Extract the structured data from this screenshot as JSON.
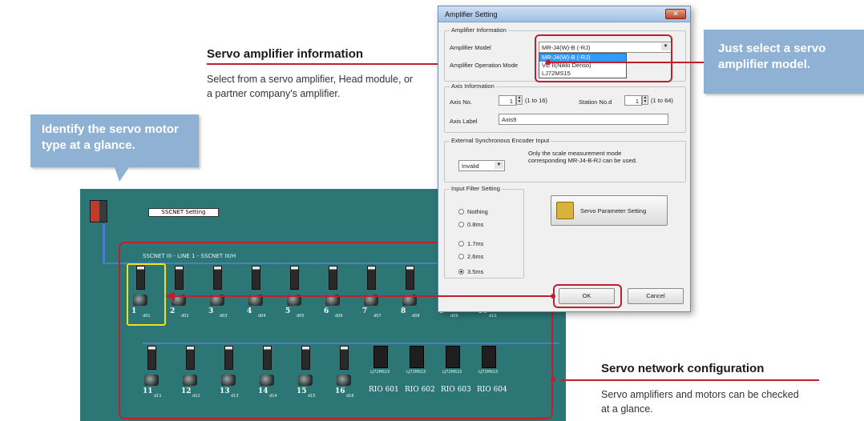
{
  "callouts": {
    "identify": "Identify the servo motor type at a glance.",
    "select_model": "Just select a servo amplifier model."
  },
  "sections": {
    "amp_info": {
      "heading": "Servo amplifier information",
      "body": "Select from a servo amplifier, Head module, or a partner company's amplifier."
    },
    "network": {
      "heading": "Servo network configuration",
      "body": "Servo amplifiers and motors can be checked at a glance."
    }
  },
  "network_panel": {
    "plc_label": "SSCNET Setting",
    "line_title": "SSCNET III - LINE 1 - SSCNET III/H",
    "row1": [
      {
        "num": "1",
        "sub": "d01"
      },
      {
        "num": "2",
        "sub": "d02"
      },
      {
        "num": "3",
        "sub": "d03"
      },
      {
        "num": "4",
        "sub": "d04"
      },
      {
        "num": "5",
        "sub": "d05"
      },
      {
        "num": "6",
        "sub": "d06"
      },
      {
        "num": "7",
        "sub": "d07"
      },
      {
        "num": "8",
        "sub": "d08"
      },
      {
        "num": "9",
        "sub": "d09"
      },
      {
        "num": "10",
        "sub": "d10"
      }
    ],
    "row2": [
      {
        "num": "11",
        "sub": "d11"
      },
      {
        "num": "12",
        "sub": "d12"
      },
      {
        "num": "13",
        "sub": "d13"
      },
      {
        "num": "14",
        "sub": "d14"
      },
      {
        "num": "15",
        "sub": "d15"
      },
      {
        "num": "16",
        "sub": "d16"
      }
    ],
    "rio": [
      {
        "label": "RIO 601",
        "tag": "LJ72MS15"
      },
      {
        "label": "RIO 602",
        "tag": "LJ72MS15"
      },
      {
        "label": "RIO 603",
        "tag": "LJ72MS15"
      },
      {
        "label": "RIO 604",
        "tag": "LJ72MS15"
      }
    ]
  },
  "dialog": {
    "title": "Amplifier Setting",
    "close": "✕",
    "amp_info_group": "Amplifier Information",
    "amp_model_label": "Amplifier Model",
    "amp_model_value": "MR-J4(W)-B (-RJ)",
    "amp_model_options": [
      "MR-J4(W)-B (-RJ)",
      "VC II(Nikki Denso)",
      "LJ72MS15"
    ],
    "amp_op_mode_label": "Amplifier Operation Mode",
    "axis_info_group": "Axis Information",
    "axis_no_label": "Axis No.",
    "axis_no_value": "1",
    "axis_no_range": "(1 to 16)",
    "station_no_label": "Station No.d",
    "station_no_value": "1",
    "station_no_range": "(1 to 64)",
    "axis_label_label": "Axis Label",
    "axis_label_value": "Axis9",
    "encoder_group": "External Synchronous Encoder Input",
    "encoder_value": "Invalid",
    "encoder_note": "Only the scale measurement mode corresponding MR-J4-B-RJ can be used.",
    "filter_group": "Input Filter Setting",
    "filter_options": [
      "Nothing",
      "0.8ms",
      "1.7ms",
      "2.6ms",
      "3.5ms"
    ],
    "filter_selected": "3.5ms",
    "param_button": "Servo Parameter Setting",
    "ok": "OK",
    "cancel": "Cancel"
  },
  "colors": {
    "callout": "#8fb1d3",
    "accent_red": "#c0202e",
    "panel": "#2d7676",
    "highlight_yellow": "#f0e21a"
  }
}
